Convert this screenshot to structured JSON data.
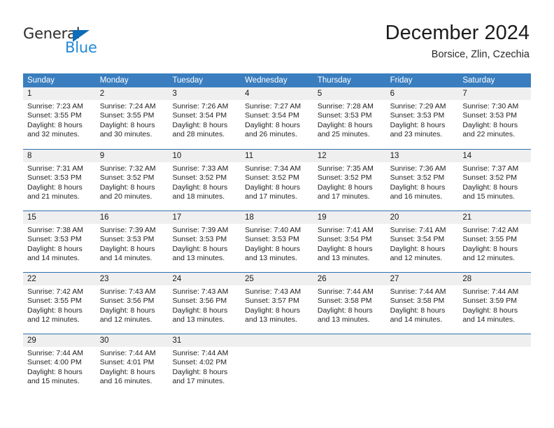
{
  "brand": {
    "name_part1": "General",
    "name_part2": "Blue",
    "triangle_color": "#0b6cb8",
    "blue_color": "#2288d6"
  },
  "header": {
    "title": "December 2024",
    "subtitle": "Borsice, Zlin, Czechia"
  },
  "theme": {
    "header_row_bg": "#3a7ebf",
    "week_divider": "#2f6fae",
    "day_number_band_bg": "#efefef",
    "text_color": "#222222"
  },
  "calendar": {
    "weekday_headers": [
      "Sunday",
      "Monday",
      "Tuesday",
      "Wednesday",
      "Thursday",
      "Friday",
      "Saturday"
    ],
    "weeks": [
      [
        {
          "day": "1",
          "sunrise": "Sunrise: 7:23 AM",
          "sunset": "Sunset: 3:55 PM",
          "daylight_line1": "Daylight: 8 hours",
          "daylight_line2": "and 32 minutes."
        },
        {
          "day": "2",
          "sunrise": "Sunrise: 7:24 AM",
          "sunset": "Sunset: 3:55 PM",
          "daylight_line1": "Daylight: 8 hours",
          "daylight_line2": "and 30 minutes."
        },
        {
          "day": "3",
          "sunrise": "Sunrise: 7:26 AM",
          "sunset": "Sunset: 3:54 PM",
          "daylight_line1": "Daylight: 8 hours",
          "daylight_line2": "and 28 minutes."
        },
        {
          "day": "4",
          "sunrise": "Sunrise: 7:27 AM",
          "sunset": "Sunset: 3:54 PM",
          "daylight_line1": "Daylight: 8 hours",
          "daylight_line2": "and 26 minutes."
        },
        {
          "day": "5",
          "sunrise": "Sunrise: 7:28 AM",
          "sunset": "Sunset: 3:53 PM",
          "daylight_line1": "Daylight: 8 hours",
          "daylight_line2": "and 25 minutes."
        },
        {
          "day": "6",
          "sunrise": "Sunrise: 7:29 AM",
          "sunset": "Sunset: 3:53 PM",
          "daylight_line1": "Daylight: 8 hours",
          "daylight_line2": "and 23 minutes."
        },
        {
          "day": "7",
          "sunrise": "Sunrise: 7:30 AM",
          "sunset": "Sunset: 3:53 PM",
          "daylight_line1": "Daylight: 8 hours",
          "daylight_line2": "and 22 minutes."
        }
      ],
      [
        {
          "day": "8",
          "sunrise": "Sunrise: 7:31 AM",
          "sunset": "Sunset: 3:53 PM",
          "daylight_line1": "Daylight: 8 hours",
          "daylight_line2": "and 21 minutes."
        },
        {
          "day": "9",
          "sunrise": "Sunrise: 7:32 AM",
          "sunset": "Sunset: 3:52 PM",
          "daylight_line1": "Daylight: 8 hours",
          "daylight_line2": "and 20 minutes."
        },
        {
          "day": "10",
          "sunrise": "Sunrise: 7:33 AM",
          "sunset": "Sunset: 3:52 PM",
          "daylight_line1": "Daylight: 8 hours",
          "daylight_line2": "and 18 minutes."
        },
        {
          "day": "11",
          "sunrise": "Sunrise: 7:34 AM",
          "sunset": "Sunset: 3:52 PM",
          "daylight_line1": "Daylight: 8 hours",
          "daylight_line2": "and 17 minutes."
        },
        {
          "day": "12",
          "sunrise": "Sunrise: 7:35 AM",
          "sunset": "Sunset: 3:52 PM",
          "daylight_line1": "Daylight: 8 hours",
          "daylight_line2": "and 17 minutes."
        },
        {
          "day": "13",
          "sunrise": "Sunrise: 7:36 AM",
          "sunset": "Sunset: 3:52 PM",
          "daylight_line1": "Daylight: 8 hours",
          "daylight_line2": "and 16 minutes."
        },
        {
          "day": "14",
          "sunrise": "Sunrise: 7:37 AM",
          "sunset": "Sunset: 3:52 PM",
          "daylight_line1": "Daylight: 8 hours",
          "daylight_line2": "and 15 minutes."
        }
      ],
      [
        {
          "day": "15",
          "sunrise": "Sunrise: 7:38 AM",
          "sunset": "Sunset: 3:53 PM",
          "daylight_line1": "Daylight: 8 hours",
          "daylight_line2": "and 14 minutes."
        },
        {
          "day": "16",
          "sunrise": "Sunrise: 7:39 AM",
          "sunset": "Sunset: 3:53 PM",
          "daylight_line1": "Daylight: 8 hours",
          "daylight_line2": "and 14 minutes."
        },
        {
          "day": "17",
          "sunrise": "Sunrise: 7:39 AM",
          "sunset": "Sunset: 3:53 PM",
          "daylight_line1": "Daylight: 8 hours",
          "daylight_line2": "and 13 minutes."
        },
        {
          "day": "18",
          "sunrise": "Sunrise: 7:40 AM",
          "sunset": "Sunset: 3:53 PM",
          "daylight_line1": "Daylight: 8 hours",
          "daylight_line2": "and 13 minutes."
        },
        {
          "day": "19",
          "sunrise": "Sunrise: 7:41 AM",
          "sunset": "Sunset: 3:54 PM",
          "daylight_line1": "Daylight: 8 hours",
          "daylight_line2": "and 13 minutes."
        },
        {
          "day": "20",
          "sunrise": "Sunrise: 7:41 AM",
          "sunset": "Sunset: 3:54 PM",
          "daylight_line1": "Daylight: 8 hours",
          "daylight_line2": "and 12 minutes."
        },
        {
          "day": "21",
          "sunrise": "Sunrise: 7:42 AM",
          "sunset": "Sunset: 3:55 PM",
          "daylight_line1": "Daylight: 8 hours",
          "daylight_line2": "and 12 minutes."
        }
      ],
      [
        {
          "day": "22",
          "sunrise": "Sunrise: 7:42 AM",
          "sunset": "Sunset: 3:55 PM",
          "daylight_line1": "Daylight: 8 hours",
          "daylight_line2": "and 12 minutes."
        },
        {
          "day": "23",
          "sunrise": "Sunrise: 7:43 AM",
          "sunset": "Sunset: 3:56 PM",
          "daylight_line1": "Daylight: 8 hours",
          "daylight_line2": "and 12 minutes."
        },
        {
          "day": "24",
          "sunrise": "Sunrise: 7:43 AM",
          "sunset": "Sunset: 3:56 PM",
          "daylight_line1": "Daylight: 8 hours",
          "daylight_line2": "and 13 minutes."
        },
        {
          "day": "25",
          "sunrise": "Sunrise: 7:43 AM",
          "sunset": "Sunset: 3:57 PM",
          "daylight_line1": "Daylight: 8 hours",
          "daylight_line2": "and 13 minutes."
        },
        {
          "day": "26",
          "sunrise": "Sunrise: 7:44 AM",
          "sunset": "Sunset: 3:58 PM",
          "daylight_line1": "Daylight: 8 hours",
          "daylight_line2": "and 13 minutes."
        },
        {
          "day": "27",
          "sunrise": "Sunrise: 7:44 AM",
          "sunset": "Sunset: 3:58 PM",
          "daylight_line1": "Daylight: 8 hours",
          "daylight_line2": "and 14 minutes."
        },
        {
          "day": "28",
          "sunrise": "Sunrise: 7:44 AM",
          "sunset": "Sunset: 3:59 PM",
          "daylight_line1": "Daylight: 8 hours",
          "daylight_line2": "and 14 minutes."
        }
      ],
      [
        {
          "day": "29",
          "sunrise": "Sunrise: 7:44 AM",
          "sunset": "Sunset: 4:00 PM",
          "daylight_line1": "Daylight: 8 hours",
          "daylight_line2": "and 15 minutes."
        },
        {
          "day": "30",
          "sunrise": "Sunrise: 7:44 AM",
          "sunset": "Sunset: 4:01 PM",
          "daylight_line1": "Daylight: 8 hours",
          "daylight_line2": "and 16 minutes."
        },
        {
          "day": "31",
          "sunrise": "Sunrise: 7:44 AM",
          "sunset": "Sunset: 4:02 PM",
          "daylight_line1": "Daylight: 8 hours",
          "daylight_line2": "and 17 minutes."
        },
        {
          "day": "",
          "sunrise": "",
          "sunset": "",
          "daylight_line1": "",
          "daylight_line2": ""
        },
        {
          "day": "",
          "sunrise": "",
          "sunset": "",
          "daylight_line1": "",
          "daylight_line2": ""
        },
        {
          "day": "",
          "sunrise": "",
          "sunset": "",
          "daylight_line1": "",
          "daylight_line2": ""
        },
        {
          "day": "",
          "sunrise": "",
          "sunset": "",
          "daylight_line1": "",
          "daylight_line2": ""
        }
      ]
    ]
  }
}
